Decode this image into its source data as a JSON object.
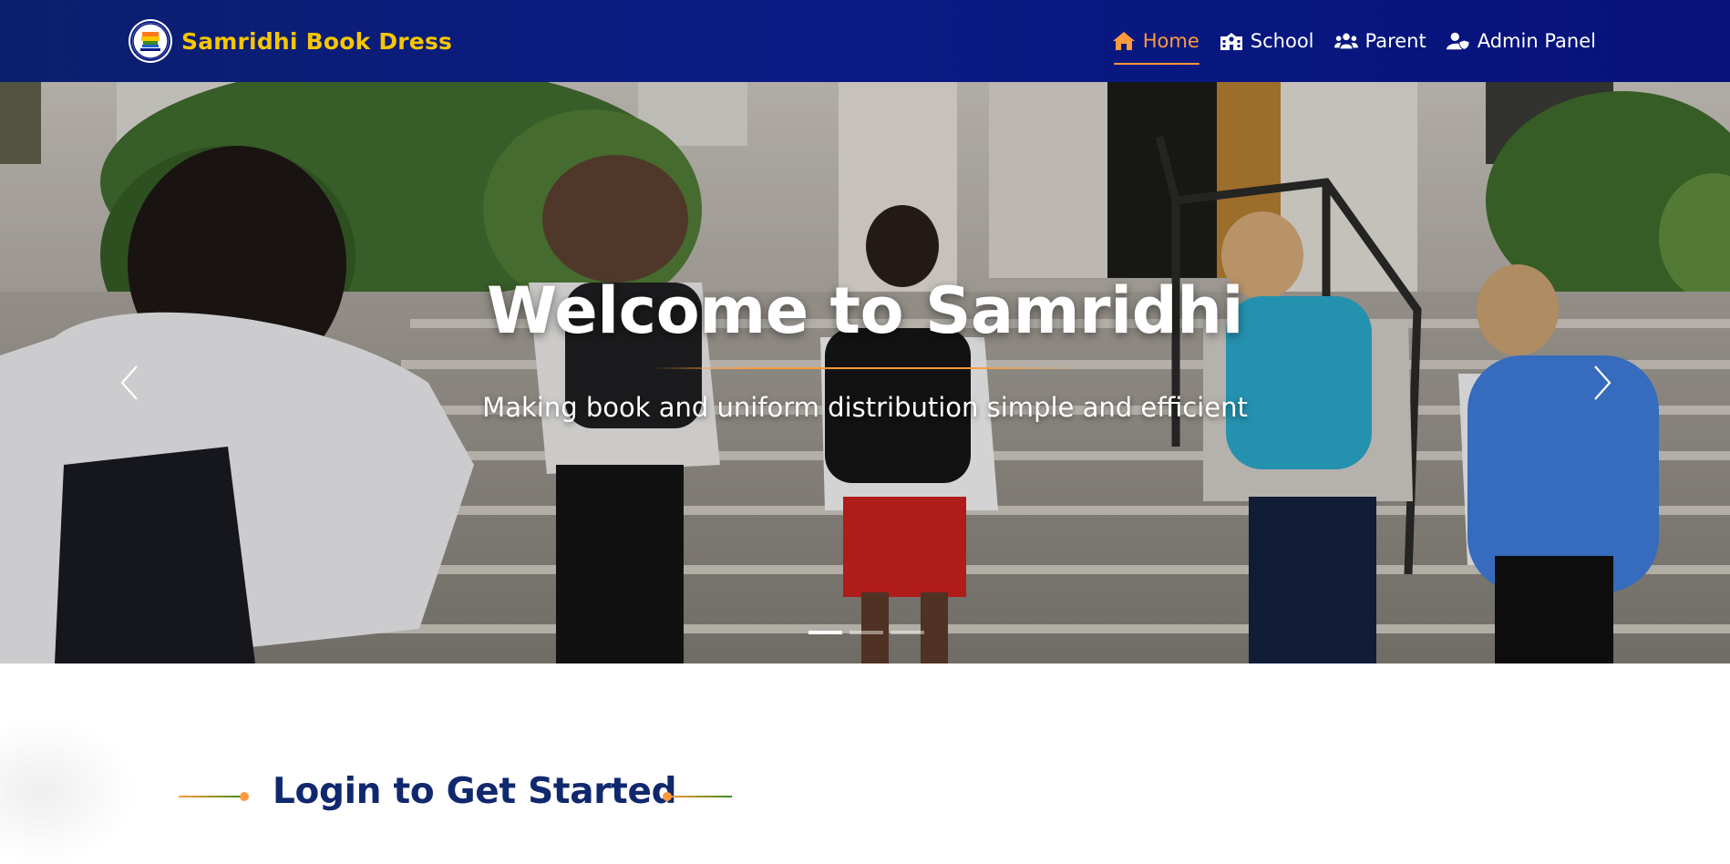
{
  "brand": {
    "name": "Samridhi Book Dress",
    "logo_icon": "samridhi-logo"
  },
  "nav": {
    "items": [
      {
        "label": "Home",
        "icon": "home-icon",
        "active": true
      },
      {
        "label": "School",
        "icon": "school-icon",
        "active": false
      },
      {
        "label": "Parent",
        "icon": "users-icon",
        "active": false
      },
      {
        "label": "Admin Panel",
        "icon": "user-shield-icon",
        "active": false
      }
    ]
  },
  "hero": {
    "title": "Welcome to Samridhi",
    "subtitle": "Making book and uniform distribution simple and efficient",
    "slides_count": 3,
    "active_slide": 1
  },
  "login": {
    "heading": "Login to Get Started"
  },
  "colors": {
    "navbar": "#0a1b85",
    "brand_text": "#f7c600",
    "accent": "#ff9a3c",
    "heading": "#10286e",
    "green": "#3a8a1e"
  }
}
